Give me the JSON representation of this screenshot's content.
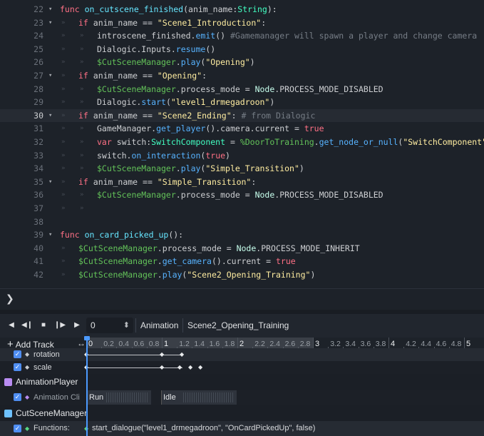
{
  "editor": {
    "lines": [
      {
        "num": "22",
        "fold": true,
        "indent": 0,
        "segs": [
          [
            "kw",
            "func "
          ],
          [
            "fndef",
            "on_cutscene_finished"
          ],
          [
            "",
            "(anim_name:"
          ],
          [
            "typ",
            "String"
          ],
          [
            "",
            "):"
          ]
        ]
      },
      {
        "num": "23",
        "fold": true,
        "indent": 1,
        "segs": [
          [
            "kw",
            "if "
          ],
          [
            "",
            "anim_name == "
          ],
          [
            "str",
            "\"Scene1_Introduction\""
          ],
          [
            "",
            ":"
          ]
        ]
      },
      {
        "num": "24",
        "fold": false,
        "indent": 2,
        "segs": [
          [
            "",
            "introscene_finished."
          ],
          [
            "fn",
            "emit"
          ],
          [
            "",
            "() "
          ],
          [
            "cmt",
            "#Gamemanager will spawn a player and change camera"
          ]
        ]
      },
      {
        "num": "25",
        "fold": false,
        "indent": 2,
        "segs": [
          [
            "",
            "Dialogic.Inputs."
          ],
          [
            "fn",
            "resume"
          ],
          [
            "",
            "()"
          ]
        ]
      },
      {
        "num": "26",
        "fold": false,
        "indent": 2,
        "segs": [
          [
            "nd",
            "$CutSceneManager"
          ],
          [
            "",
            "."
          ],
          [
            "fn",
            "play"
          ],
          [
            "",
            "("
          ],
          [
            "str",
            "\"Opening\""
          ],
          [
            "",
            ")"
          ]
        ]
      },
      {
        "num": "27",
        "fold": true,
        "indent": 1,
        "segs": [
          [
            "kw",
            "if "
          ],
          [
            "",
            "anim_name == "
          ],
          [
            "str",
            "\"Opening\""
          ],
          [
            "",
            ":"
          ]
        ]
      },
      {
        "num": "28",
        "fold": false,
        "indent": 2,
        "segs": [
          [
            "nd",
            "$CutSceneManager"
          ],
          [
            "",
            ".process_mode = "
          ],
          [
            "cls",
            "Node"
          ],
          [
            "",
            ".PROCESS_MODE_DISABLED"
          ]
        ]
      },
      {
        "num": "29",
        "fold": false,
        "indent": 2,
        "segs": [
          [
            "",
            "Dialogic."
          ],
          [
            "fn",
            "start"
          ],
          [
            "",
            "("
          ],
          [
            "str",
            "\"level1_drmegadroon\""
          ],
          [
            "",
            ")"
          ]
        ]
      },
      {
        "num": "30",
        "fold": true,
        "indent": 1,
        "current": true,
        "segs": [
          [
            "kw",
            "if "
          ],
          [
            "",
            "anim_name == "
          ],
          [
            "str",
            "\"Scene2_Ending\""
          ],
          [
            "",
            ": "
          ],
          [
            "cmt",
            "# from Dialogic"
          ]
        ]
      },
      {
        "num": "31",
        "fold": false,
        "indent": 2,
        "segs": [
          [
            "",
            "GameManager."
          ],
          [
            "fn",
            "get_player"
          ],
          [
            "",
            "().camera.current = "
          ],
          [
            "kw",
            "true"
          ]
        ]
      },
      {
        "num": "32",
        "fold": false,
        "indent": 2,
        "segs": [
          [
            "kw",
            "var "
          ],
          [
            "",
            "switch:"
          ],
          [
            "typ",
            "SwitchComponent"
          ],
          [
            "",
            " = "
          ],
          [
            "nd",
            "%DoorToTraining"
          ],
          [
            "",
            "."
          ],
          [
            "fn",
            "get_node_or_null"
          ],
          [
            "",
            "("
          ],
          [
            "str",
            "\"SwitchComponent\""
          ],
          [
            "",
            ")"
          ]
        ]
      },
      {
        "num": "33",
        "fold": false,
        "indent": 2,
        "segs": [
          [
            "",
            "switch."
          ],
          [
            "fn",
            "on_interaction"
          ],
          [
            "",
            "("
          ],
          [
            "kw",
            "true"
          ],
          [
            "",
            ")"
          ]
        ]
      },
      {
        "num": "34",
        "fold": false,
        "indent": 2,
        "segs": [
          [
            "nd",
            "$CutSceneManager"
          ],
          [
            "",
            "."
          ],
          [
            "fn",
            "play"
          ],
          [
            "",
            "("
          ],
          [
            "str",
            "\"Simple_Transition\""
          ],
          [
            "",
            ")"
          ]
        ]
      },
      {
        "num": "35",
        "fold": true,
        "indent": 1,
        "segs": [
          [
            "kw",
            "if "
          ],
          [
            "",
            "anim_name == "
          ],
          [
            "str",
            "\"Simple_Transition\""
          ],
          [
            "",
            ":"
          ]
        ]
      },
      {
        "num": "36",
        "fold": false,
        "indent": 2,
        "segs": [
          [
            "nd",
            "$CutSceneManager"
          ],
          [
            "",
            ".process_mode = "
          ],
          [
            "cls",
            "Node"
          ],
          [
            "",
            ".PROCESS_MODE_DISABLED"
          ]
        ]
      },
      {
        "num": "37",
        "fold": false,
        "indent": 2,
        "segs": []
      },
      {
        "num": "38",
        "fold": false,
        "indent": 0,
        "segs": []
      },
      {
        "num": "39",
        "fold": true,
        "indent": 0,
        "segs": [
          [
            "kw",
            "func "
          ],
          [
            "fndef",
            "on_card_picked_up"
          ],
          [
            "",
            "():"
          ]
        ]
      },
      {
        "num": "40",
        "fold": false,
        "indent": 1,
        "segs": [
          [
            "nd",
            "$CutSceneManager"
          ],
          [
            "",
            ".process_mode = "
          ],
          [
            "cls",
            "Node"
          ],
          [
            "",
            ".PROCESS_MODE_INHERIT"
          ]
        ]
      },
      {
        "num": "41",
        "fold": false,
        "indent": 1,
        "segs": [
          [
            "nd",
            "$CutSceneManager"
          ],
          [
            "",
            "."
          ],
          [
            "fn",
            "get_camera"
          ],
          [
            "",
            "().current = "
          ],
          [
            "kw",
            "true"
          ]
        ]
      },
      {
        "num": "42",
        "fold": false,
        "indent": 1,
        "segs": [
          [
            "nd",
            "$CutSceneManager"
          ],
          [
            "",
            "."
          ],
          [
            "fn",
            "play"
          ],
          [
            "",
            "("
          ],
          [
            "str",
            "\"Scene2_Opening_Training\""
          ],
          [
            "",
            ")"
          ]
        ]
      }
    ]
  },
  "status": {
    "chevron": "❯"
  },
  "animation": {
    "toolbar": {
      "time_value": "0",
      "menu_label": "Animation",
      "current_animation": "Scene2_Opening_Training"
    },
    "add_track_label": "Add Track",
    "ruler_ticks": [
      "0",
      "0.2",
      "0.4",
      "0.6",
      "0.8",
      "1",
      "1.2",
      "1.4",
      "1.6",
      "1.8",
      "2",
      "2.2",
      "2.4",
      "2.6",
      "2.8",
      "3",
      "3.2",
      "3.4",
      "3.6",
      "3.8",
      "4",
      "4.2",
      "4.4",
      "4.6",
      "4.8",
      "5"
    ],
    "tracks": {
      "rotation_label": "rotation",
      "scale_label": "scale",
      "animation_player_label": "AnimationPlayer",
      "animation_clip_label": "Animation Cli",
      "clip_run": "Run",
      "clip_idle": "Idle",
      "cutscene_manager_label": "CutSceneManager",
      "functions_label": "Functions:",
      "function_call": "start_dialogue(\"level1_drmegadroon\", \"OnCardPickedUp\", false)"
    }
  }
}
